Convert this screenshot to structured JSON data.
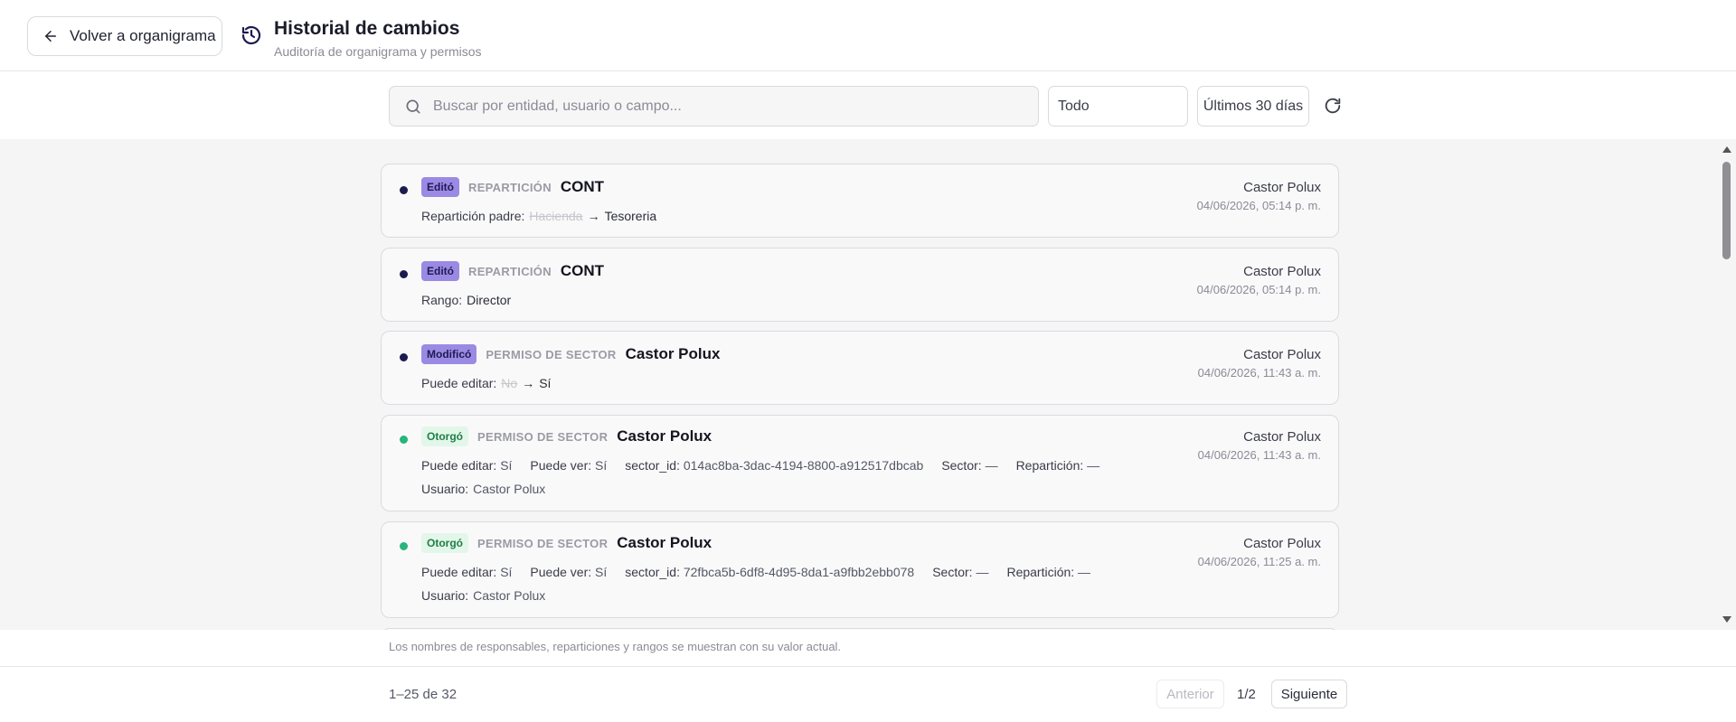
{
  "header": {
    "back_label": "Volver a organigrama",
    "title": "Historial de cambios",
    "subtitle": "Auditoría de organigrama y permisos"
  },
  "filters": {
    "search_placeholder": "Buscar por entidad, usuario o campo...",
    "type_value": "Todo",
    "range_value": "Últimos 30 días"
  },
  "entries": [
    {
      "action": "Editó",
      "entity_type": "REPARTICIÓN",
      "entity_name": "CONT",
      "field_label": "Repartición padre:",
      "old_value": "Hacienda",
      "arrow": "→",
      "new_value": "Tesoreria",
      "user": "Castor Polux",
      "date": "04/06/2026, 05:14 p. m."
    },
    {
      "action": "Editó",
      "entity_type": "REPARTICIÓN",
      "entity_name": "CONT",
      "field_label": "Rango:",
      "new_value": "Director",
      "user": "Castor Polux",
      "date": "04/06/2026, 05:14 p. m."
    },
    {
      "action": "Modificó",
      "entity_type": "PERMISO DE SECTOR",
      "entity_name": "Castor Polux",
      "field_label": "Puede editar:",
      "old_value": "No",
      "arrow": "→",
      "new_value": "Sí",
      "user": "Castor Polux",
      "date": "04/06/2026, 11:43 a. m."
    },
    {
      "action": "Otorgó",
      "entity_type": "PERMISO DE SECTOR",
      "entity_name": "Castor Polux",
      "fields": [
        {
          "label": "Puede editar:",
          "value": "Sí"
        },
        {
          "label": "Puede ver:",
          "value": "Sí"
        },
        {
          "label": "sector_id:",
          "value": "014ac8ba-3dac-4194-8800-a912517dbcab"
        },
        {
          "label": "Sector:",
          "value": "—"
        },
        {
          "label": "Repartición:",
          "value": "—"
        }
      ],
      "extra_label": "Usuario:",
      "extra_value": "Castor Polux",
      "user": "Castor Polux",
      "date": "04/06/2026, 11:43 a. m."
    },
    {
      "action": "Otorgó",
      "entity_type": "PERMISO DE SECTOR",
      "entity_name": "Castor Polux",
      "fields": [
        {
          "label": "Puede editar:",
          "value": "Sí"
        },
        {
          "label": "Puede ver:",
          "value": "Sí"
        },
        {
          "label": "sector_id:",
          "value": "72fbca5b-6df8-4d95-8da1-a9fbb2ebb078"
        },
        {
          "label": "Sector:",
          "value": "—"
        },
        {
          "label": "Repartición:",
          "value": "—"
        }
      ],
      "extra_label": "Usuario:",
      "extra_value": "Castor Polux",
      "user": "Castor Polux",
      "date": "04/06/2026, 11:25 a. m."
    }
  ],
  "footer": {
    "note": "Los nombres de responsables, reparticiones y rangos se muestran con su valor actual.",
    "count": "1–25 de 32",
    "prev_label": "Anterior",
    "page": "1/2",
    "next_label": "Siguiente"
  },
  "colors": {
    "badge_edit": "#9b8ae3",
    "badge_grant_bg": "#e3f6ea",
    "badge_grant_text": "#1e7f45",
    "dot_dark": "#1c1b4f",
    "dot_green": "#26b57a"
  }
}
